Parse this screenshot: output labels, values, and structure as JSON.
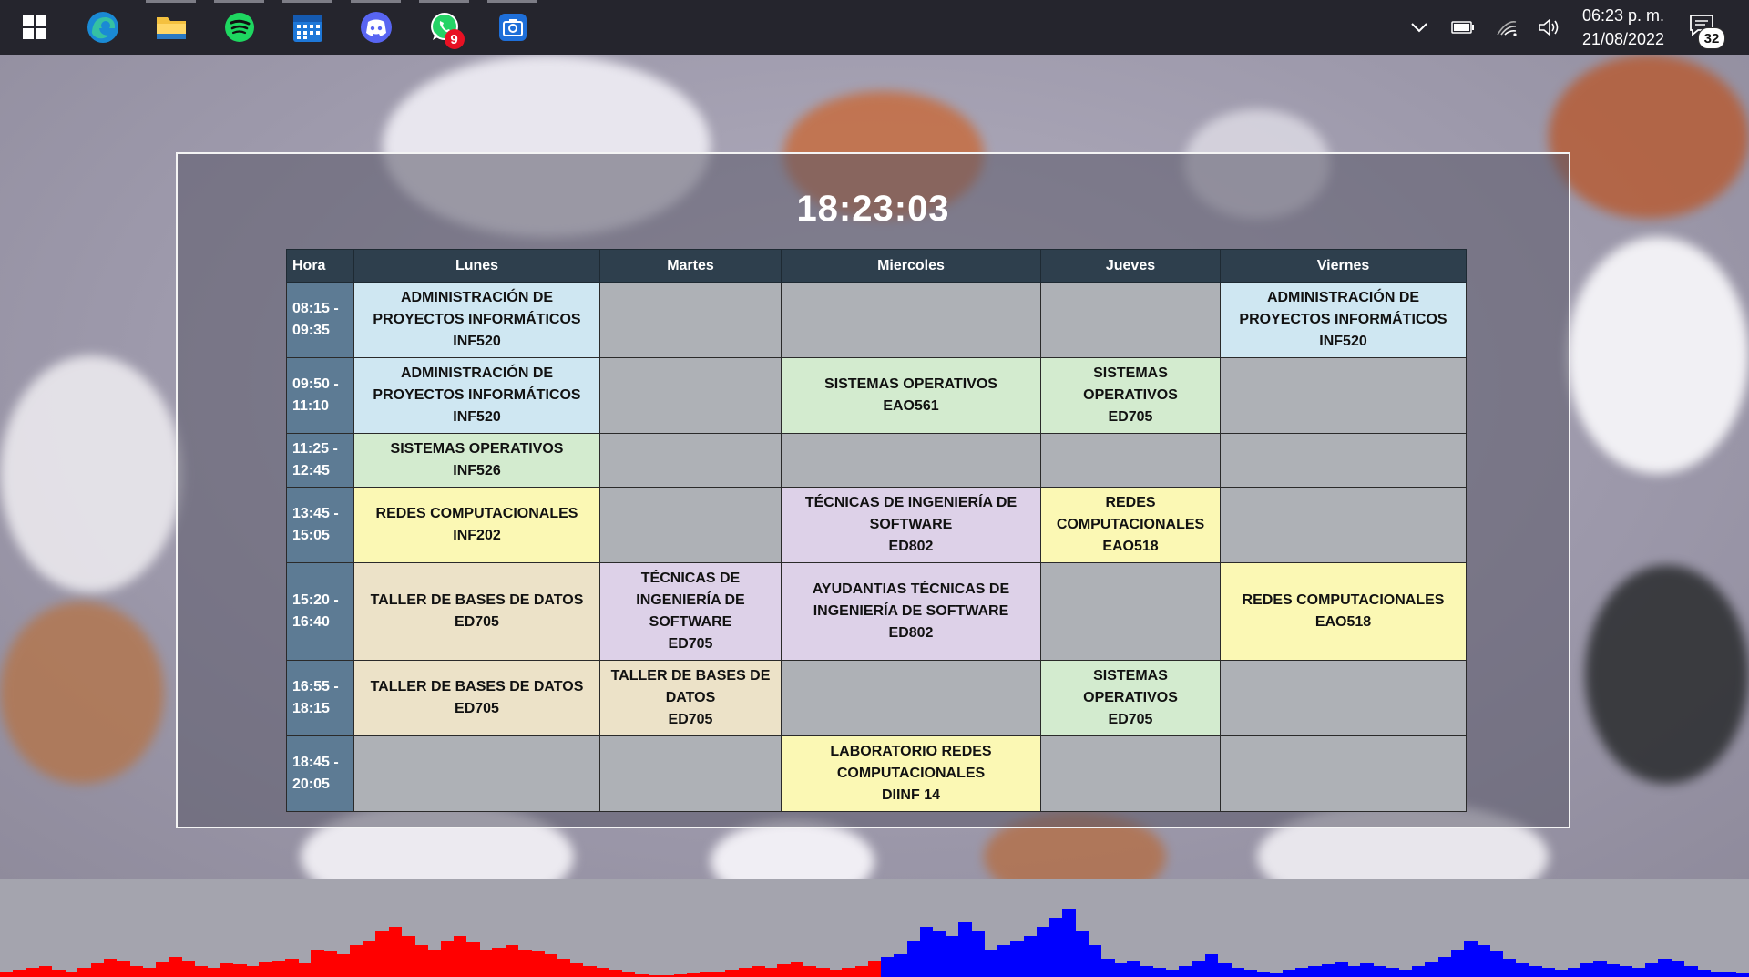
{
  "taskbar": {
    "apps": [
      {
        "name": "start",
        "icon": "windows-start-icon",
        "running": false
      },
      {
        "name": "edge",
        "icon": "edge-icon",
        "running": false
      },
      {
        "name": "file-explorer",
        "icon": "folder-icon",
        "running": true
      },
      {
        "name": "spotify",
        "icon": "spotify-icon",
        "running": true
      },
      {
        "name": "calendar",
        "icon": "calendar-icon",
        "running": true
      },
      {
        "name": "discord",
        "icon": "discord-icon",
        "running": true
      },
      {
        "name": "whatsapp",
        "icon": "whatsapp-icon",
        "running": true,
        "badge": "9"
      },
      {
        "name": "screenshot",
        "icon": "camera-app-icon",
        "running": true
      }
    ],
    "tray": {
      "time": "06:23 p. m.",
      "date": "21/08/2022",
      "notifications": "32"
    }
  },
  "widget": {
    "clock": "18:23:03",
    "headers": [
      "Hora",
      "Lunes",
      "Martes",
      "Miercoles",
      "Jueves",
      "Viernes"
    ],
    "rows": [
      {
        "time": [
          "08:15 -",
          "09:35"
        ],
        "cells": [
          {
            "lines": [
              "ADMINISTRACIÓN DE",
              "PROYECTOS INFORMÁTICOS",
              "INF520"
            ],
            "color": "blue"
          },
          {
            "lines": [],
            "color": "empty"
          },
          {
            "lines": [],
            "color": "empty"
          },
          {
            "lines": [],
            "color": "empty"
          },
          {
            "lines": [
              "ADMINISTRACIÓN DE",
              "PROYECTOS INFORMÁTICOS",
              "INF520"
            ],
            "color": "blue"
          }
        ]
      },
      {
        "time": [
          "09:50 -",
          "11:10"
        ],
        "cells": [
          {
            "lines": [
              "ADMINISTRACIÓN DE",
              "PROYECTOS INFORMÁTICOS",
              "INF520"
            ],
            "color": "blue"
          },
          {
            "lines": [],
            "color": "empty"
          },
          {
            "lines": [
              "SISTEMAS OPERATIVOS",
              "EAO561"
            ],
            "color": "green"
          },
          {
            "lines": [
              "SISTEMAS",
              "OPERATIVOS",
              "ED705"
            ],
            "color": "green"
          },
          {
            "lines": [],
            "color": "empty"
          }
        ]
      },
      {
        "time": [
          "11:25 -",
          "12:45"
        ],
        "cells": [
          {
            "lines": [
              "SISTEMAS OPERATIVOS",
              "INF526"
            ],
            "color": "green"
          },
          {
            "lines": [],
            "color": "empty"
          },
          {
            "lines": [],
            "color": "empty"
          },
          {
            "lines": [],
            "color": "empty"
          },
          {
            "lines": [],
            "color": "empty"
          }
        ]
      },
      {
        "time": [
          "13:45 -",
          "15:05"
        ],
        "cells": [
          {
            "lines": [
              "REDES COMPUTACIONALES",
              "INF202"
            ],
            "color": "yellow"
          },
          {
            "lines": [],
            "color": "empty"
          },
          {
            "lines": [
              "TÉCNICAS DE INGENIERÍA DE",
              "SOFTWARE",
              "ED802"
            ],
            "color": "purple"
          },
          {
            "lines": [
              "REDES",
              "COMPUTACIONALES",
              "EAO518"
            ],
            "color": "yellow"
          },
          {
            "lines": [],
            "color": "empty"
          }
        ]
      },
      {
        "time": [
          "15:20 -",
          "16:40"
        ],
        "cells": [
          {
            "lines": [
              "TALLER DE BASES DE DATOS",
              "ED705"
            ],
            "color": "beige"
          },
          {
            "lines": [
              "TÉCNICAS DE",
              "INGENIERÍA DE",
              "SOFTWARE",
              "ED705"
            ],
            "color": "purple"
          },
          {
            "lines": [
              "AYUDANTIAS TÉCNICAS DE",
              "INGENIERÍA DE SOFTWARE",
              "ED802"
            ],
            "color": "purple"
          },
          {
            "lines": [],
            "color": "empty"
          },
          {
            "lines": [
              "REDES COMPUTACIONALES",
              "EAO518"
            ],
            "color": "yellow"
          }
        ]
      },
      {
        "time": [
          "16:55 -",
          "18:15"
        ],
        "cells": [
          {
            "lines": [
              "TALLER DE BASES DE DATOS",
              "ED705"
            ],
            "color": "beige"
          },
          {
            "lines": [
              "TALLER DE BASES DE",
              "DATOS",
              "ED705"
            ],
            "color": "beige"
          },
          {
            "lines": [],
            "color": "empty"
          },
          {
            "lines": [
              "SISTEMAS",
              "OPERATIVOS",
              "ED705"
            ],
            "color": "green"
          },
          {
            "lines": [],
            "color": "empty"
          }
        ]
      },
      {
        "time": [
          "18:45 -",
          "20:05"
        ],
        "cells": [
          {
            "lines": [],
            "color": "empty"
          },
          {
            "lines": [],
            "color": "empty"
          },
          {
            "lines": [
              "LABORATORIO REDES",
              "COMPUTACIONALES",
              "DIINF 14"
            ],
            "color": "yellow"
          },
          {
            "lines": [],
            "color": "empty"
          },
          {
            "lines": [],
            "color": "empty"
          }
        ]
      }
    ]
  },
  "visualizer": {
    "left_color": "#ff0000",
    "right_color": "#0000ff",
    "levels": [
      0.05,
      0.08,
      0.1,
      0.12,
      0.08,
      0.06,
      0.1,
      0.15,
      0.2,
      0.18,
      0.12,
      0.1,
      0.16,
      0.22,
      0.18,
      0.12,
      0.1,
      0.15,
      0.14,
      0.12,
      0.16,
      0.18,
      0.2,
      0.15,
      0.3,
      0.28,
      0.25,
      0.35,
      0.4,
      0.5,
      0.55,
      0.45,
      0.35,
      0.3,
      0.4,
      0.45,
      0.38,
      0.3,
      0.32,
      0.35,
      0.3,
      0.28,
      0.25,
      0.2,
      0.15,
      0.12,
      0.1,
      0.08,
      0.05,
      0.03,
      0.02,
      0.02,
      0.03,
      0.04,
      0.05,
      0.06,
      0.08,
      0.1,
      0.12,
      0.1,
      0.14,
      0.16,
      0.12,
      0.1,
      0.08,
      0.1,
      0.12,
      0.18,
      0.22,
      0.25,
      0.4,
      0.55,
      0.5,
      0.45,
      0.6,
      0.5,
      0.3,
      0.35,
      0.4,
      0.45,
      0.55,
      0.65,
      0.75,
      0.5,
      0.35,
      0.2,
      0.15,
      0.18,
      0.12,
      0.1,
      0.08,
      0.12,
      0.18,
      0.25,
      0.15,
      0.1,
      0.08,
      0.05,
      0.04,
      0.08,
      0.1,
      0.12,
      0.14,
      0.16,
      0.12,
      0.15,
      0.12,
      0.1,
      0.08,
      0.12,
      0.16,
      0.22,
      0.3,
      0.4,
      0.35,
      0.28,
      0.2,
      0.15,
      0.12,
      0.1,
      0.08,
      0.1,
      0.15,
      0.18,
      0.14,
      0.12,
      0.1,
      0.15,
      0.2,
      0.18,
      0.12,
      0.08,
      0.06,
      0.05,
      0.04
    ]
  }
}
